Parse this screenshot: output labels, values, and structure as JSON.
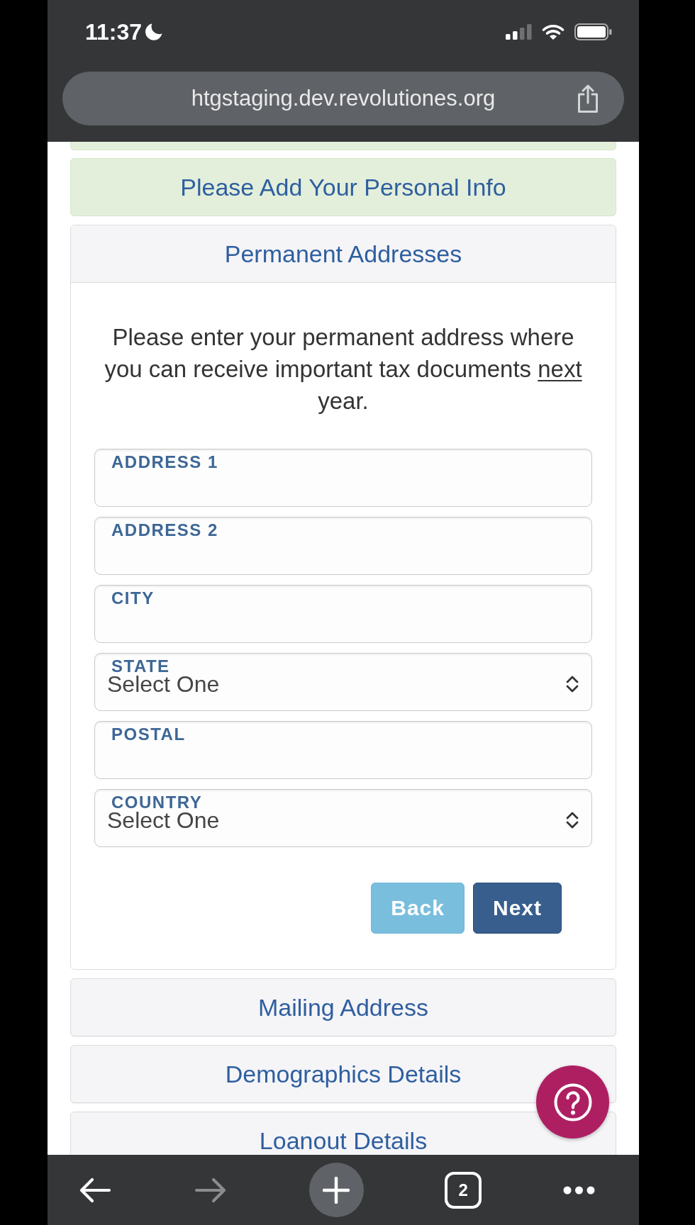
{
  "status_bar": {
    "time": "11:37"
  },
  "address_bar": {
    "url": "htgstaging.dev.revolutiones.org"
  },
  "banner": {
    "title": "Please Add Your Personal Info"
  },
  "sections": [
    {
      "title": "Permanent Addresses",
      "expanded": true,
      "intro": [
        {
          "text": "Please enter your permanent address where you can receive important tax documents ",
          "underline": false
        },
        {
          "text": "next",
          "underline": true
        },
        {
          "text": " year.",
          "underline": false
        }
      ],
      "fields": [
        {
          "kind": "text",
          "label": "ADDRESS 1"
        },
        {
          "kind": "text",
          "label": "ADDRESS 2"
        },
        {
          "kind": "text",
          "label": "CITY"
        },
        {
          "kind": "select",
          "label": "STATE",
          "value": "Select One"
        },
        {
          "kind": "text",
          "label": "POSTAL"
        },
        {
          "kind": "select",
          "label": "COUNTRY",
          "value": "Select One"
        }
      ],
      "buttons": [
        {
          "kind": "secondary",
          "label": "Back"
        },
        {
          "kind": "primary",
          "label": "Next"
        }
      ]
    },
    {
      "title": "Mailing Address",
      "expanded": false
    },
    {
      "title": "Demographics Details",
      "expanded": false
    },
    {
      "title": "Loanout Details",
      "expanded": false
    }
  ],
  "toolbar": {
    "buttons": [
      {
        "kind": "back",
        "disabled": false
      },
      {
        "kind": "forward",
        "disabled": true
      },
      {
        "kind": "new_tab",
        "disabled": false
      },
      {
        "kind": "tabs",
        "label": "2",
        "disabled": false
      },
      {
        "kind": "more",
        "disabled": false
      }
    ]
  }
}
